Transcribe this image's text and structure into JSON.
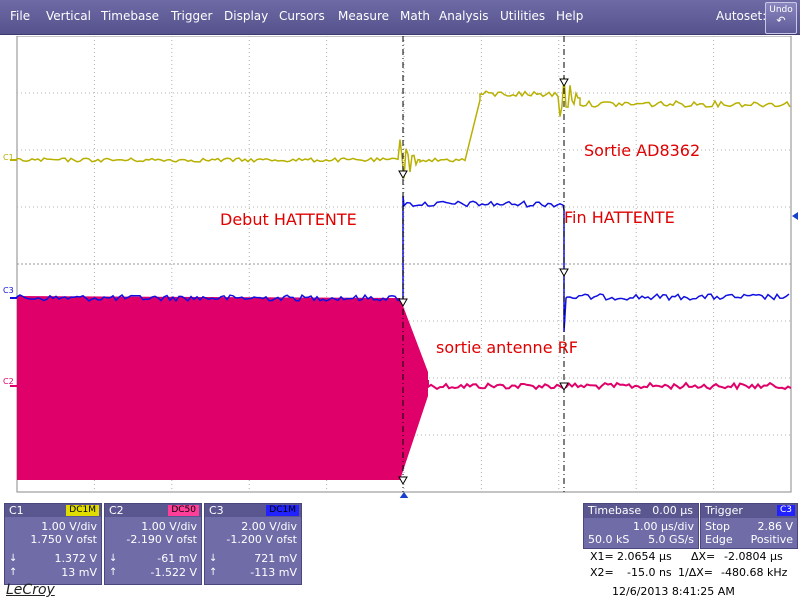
{
  "menu": [
    "File",
    "Vertical",
    "Timebase",
    "Trigger",
    "Display",
    "Cursors",
    "Measure",
    "Math",
    "Analysis",
    "Utilities",
    "Help"
  ],
  "autoset_label": "Autoset:",
  "undo_label": "Undo",
  "channel_tags": {
    "c1": "C1",
    "c2": "C2",
    "c3": "C3"
  },
  "annotations": {
    "sortie_ad": "Sortie AD8362",
    "debut": "Debut HATTENTE",
    "fin": "Fin HATTENTE",
    "antenne": "sortie antenne RF"
  },
  "channels": [
    {
      "name": "C1",
      "coupling": "DC1M",
      "vdiv": "1.00 V/div",
      "offset": "1.750 V ofst",
      "meas1": "1.372 V",
      "meas2": "13 mV",
      "color": "#b8b000"
    },
    {
      "name": "C2",
      "coupling": "DC50",
      "vdiv": "1.00 V/div",
      "offset": "-2.190 V ofst",
      "meas1": "-61 mV",
      "meas2": "-1.522 V",
      "color": "#e0006a"
    },
    {
      "name": "C3",
      "coupling": "DC1M",
      "vdiv": "2.00 V/div",
      "offset": "-1.200 V ofst",
      "meas1": "721 mV",
      "meas2": "-113 mV",
      "color": "#1010e0"
    }
  ],
  "timebase": {
    "label": "Timebase",
    "delay": "0.00 µs",
    "tdiv": "1.00 µs/div",
    "samples": "50.0 kS",
    "rate": "5.0 GS/s"
  },
  "trigger": {
    "label": "Trigger",
    "source": "C3",
    "mode": "Stop",
    "level": "2.86 V",
    "type": "Edge",
    "slope": "Positive"
  },
  "cursors": {
    "x1_label": "X1=",
    "x1": "2.0654 µs",
    "dx_label": "ΔX=",
    "dx": "-2.0804 µs",
    "x2_label": "X2=",
    "x2": "-15.0 ns",
    "inv_label": "1/ΔX=",
    "inv": "-480.68 kHz"
  },
  "logo": "LeCroy",
  "timestamp": "12/6/2013 8:41:25 AM",
  "colors": {
    "c1": "#b8b000",
    "c2": "#e0006a",
    "c3": "#1010e0",
    "annotation": "#e00000",
    "menubar": "#5e5a98"
  }
}
